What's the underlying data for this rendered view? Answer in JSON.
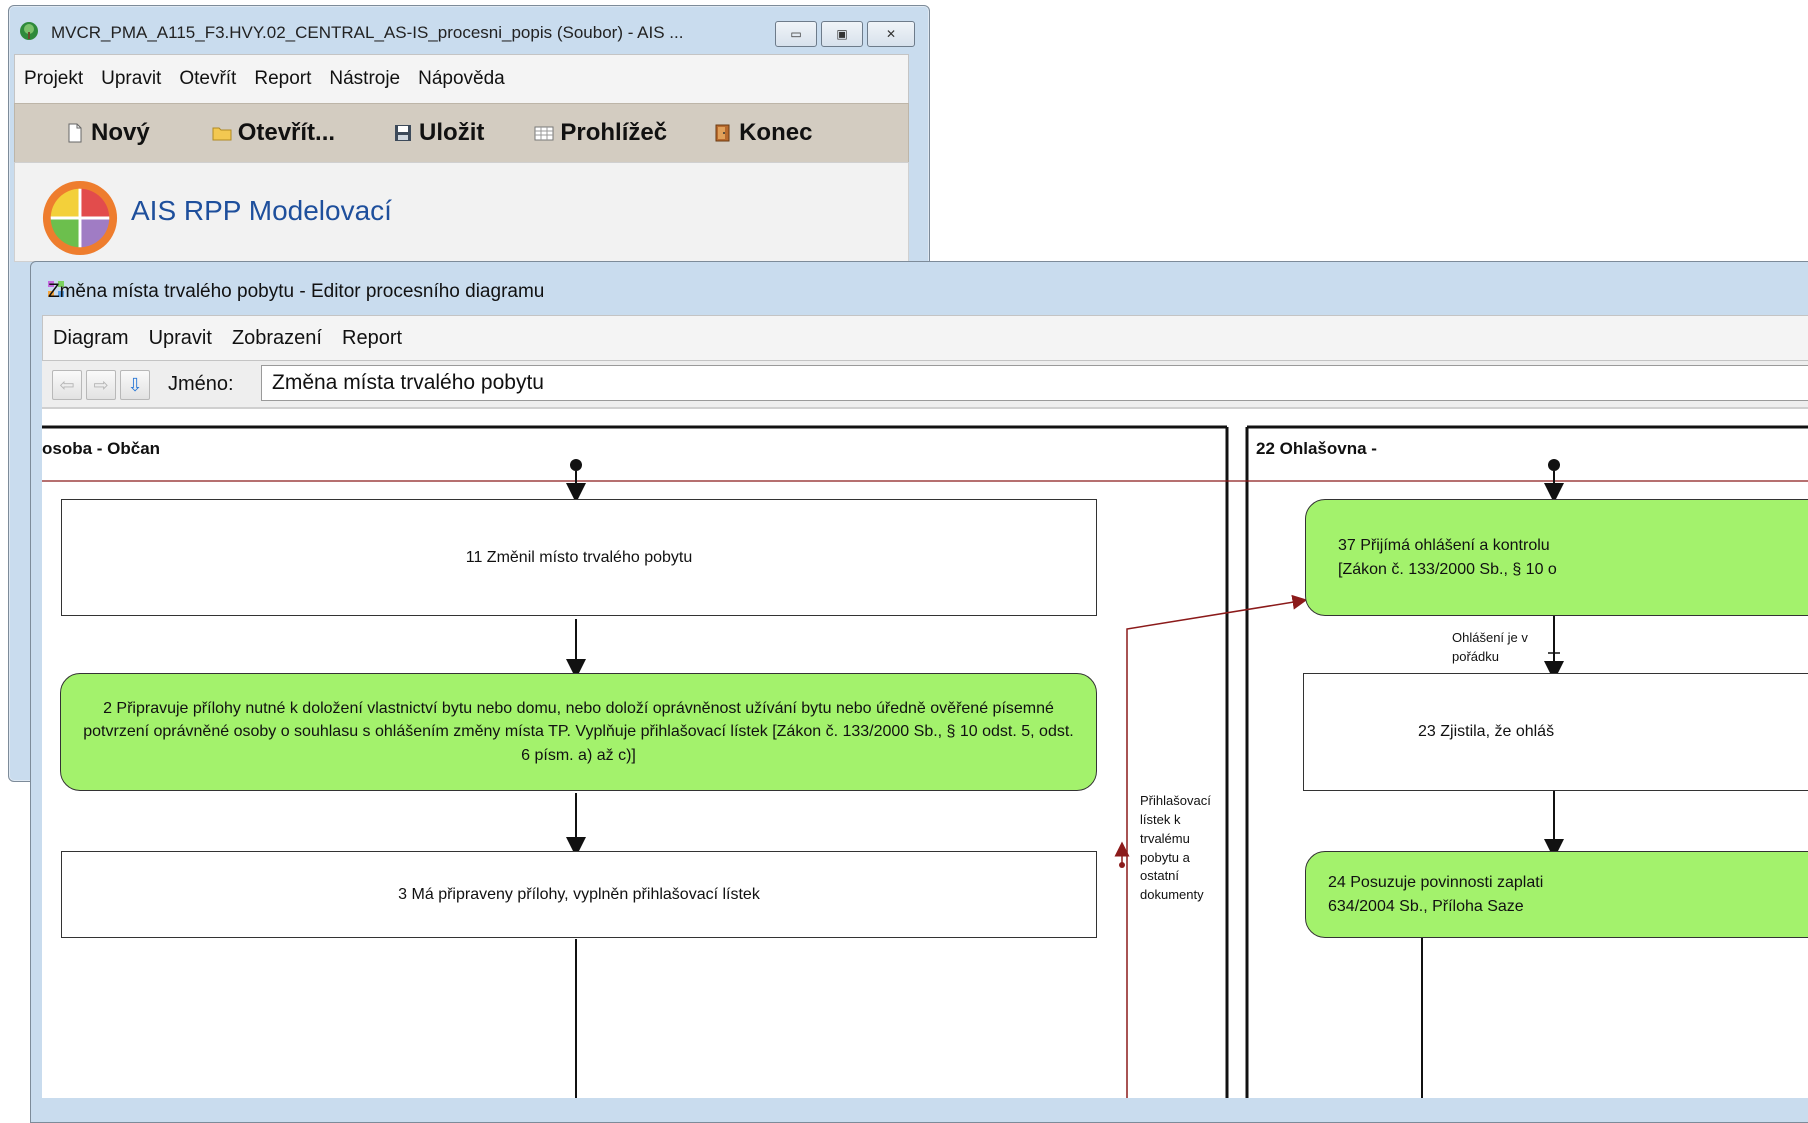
{
  "main_window": {
    "title": "MVCR_PMA_A115_F3.HVY.02_CENTRAL_AS-IS_procesni_popis (Soubor) - AIS ...",
    "controls": {
      "minimize": "▭",
      "maximize": "▣",
      "close": "✕"
    },
    "menu": [
      "Projekt",
      "Upravit",
      "Otevřít",
      "Report",
      "Nástroje",
      "Nápověda"
    ],
    "toolbar": {
      "new": "Nový",
      "open": "Otevřít...",
      "save": "Uložit",
      "viewer": "Prohlížeč",
      "exit": "Konec"
    },
    "app_name": "AIS RPP Modelovací"
  },
  "editor": {
    "title": "Změna místa trvalého pobytu - Editor procesního diagramu",
    "menu": [
      "Diagram",
      "Upravit",
      "Zobrazení",
      "Report"
    ],
    "name_label": "Jméno:",
    "name_value": "Změna místa trvalého pobytu",
    "nav": {
      "back": "⇦",
      "forward": "⇨",
      "down": "⇩"
    }
  },
  "diagram": {
    "lanes": [
      {
        "title": "osoba - Občan"
      },
      {
        "title": "22 Ohlašovna -"
      }
    ],
    "nodes": {
      "n11": "11 Změnil místo trvalého pobytu",
      "n2": "2 Připravuje přílohy nutné k doložení vlastnictví bytu nebo domu, nebo doloží oprávněnost užívání bytu nebo úředně ověřené písemné potvrzení oprávněné osoby o souhlasu s ohlášením změny místa TP. Vyplňuje přihlašovací lístek [Zákon č. 133/2000 Sb., § 10 odst. 5, odst. 6 písm. a) až c)]",
      "n3": "3 Má připraveny přílohy, vyplněn přihlašovací lístek",
      "n37_line1": "37 Přijímá ohlášení a kontrolu",
      "n37_line2": "[Zákon č. 133/2000 Sb., § 10 o",
      "n23": "23 Zjistila, že ohláš",
      "n24_line1": "24 Posuzuje povinnosti zaplati",
      "n24_line2": "634/2004 Sb., Příloha Saze"
    },
    "labels": {
      "ohlaseni": "Ohlášení je v pořádku",
      "prihlasovaci": "Přihlašovací lístek k trvalému pobytu a ostatní dokumenty"
    }
  }
}
